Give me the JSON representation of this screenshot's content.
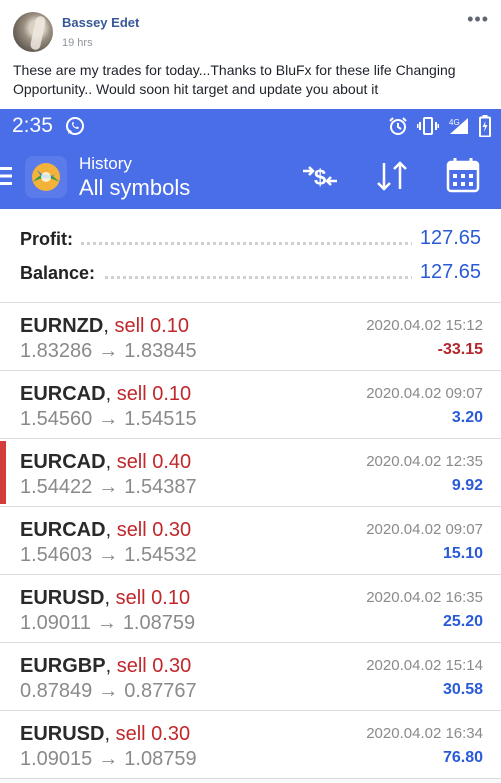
{
  "post": {
    "author": "Bassey Edet",
    "time": "19 hrs",
    "more": "•••",
    "text": "These are my trades for today...Thanks to BluFx for these life Changing Opportunity.. Would soon hit target and update you about it"
  },
  "phone": {
    "status": {
      "clock": "2:35",
      "icons": [
        "whatsapp-icon",
        "alarm-icon",
        "vibrate-icon",
        "4g-signal-icon",
        "battery-icon"
      ]
    },
    "appbar": {
      "title_small": "History",
      "title_large": "All symbols",
      "icons": [
        "menu-icon",
        "metatrader-logo-icon",
        "deposit-exchange-icon",
        "sort-icon",
        "calendar-icon"
      ]
    },
    "summary": [
      {
        "label": "Profit:",
        "value": "127.65"
      },
      {
        "label": "Balance:",
        "value": "127.65"
      }
    ],
    "trades": [
      {
        "symbol": "EURNZD",
        "side": "sell 0.10",
        "open": "1.83286",
        "close": "1.83845",
        "time": "2020.04.02 15:12",
        "pl": "-33.15",
        "pl_color": "#b3262b",
        "selected": false
      },
      {
        "symbol": "EURCAD",
        "side": "sell 0.10",
        "open": "1.54560",
        "close": "1.54515",
        "time": "2020.04.02 09:07",
        "pl": "3.20",
        "pl_color": "#2a5bd7",
        "selected": false
      },
      {
        "symbol": "EURCAD",
        "side": "sell 0.40",
        "open": "1.54422",
        "close": "1.54387",
        "time": "2020.04.02 12:35",
        "pl": "9.92",
        "pl_color": "#2a5bd7",
        "selected": true
      },
      {
        "symbol": "EURCAD",
        "side": "sell 0.30",
        "open": "1.54603",
        "close": "1.54532",
        "time": "2020.04.02 09:07",
        "pl": "15.10",
        "pl_color": "#2a5bd7",
        "selected": false
      },
      {
        "symbol": "EURUSD",
        "side": "sell 0.10",
        "open": "1.09011",
        "close": "1.08759",
        "time": "2020.04.02 16:35",
        "pl": "25.20",
        "pl_color": "#2a5bd7",
        "selected": false
      },
      {
        "symbol": "EURGBP",
        "side": "sell 0.30",
        "open": "0.87849",
        "close": "0.87767",
        "time": "2020.04.02 15:14",
        "pl": "30.58",
        "pl_color": "#2a5bd7",
        "selected": false
      },
      {
        "symbol": "EURUSD",
        "side": "sell 0.30",
        "open": "1.09015",
        "close": "1.08759",
        "time": "2020.04.02 16:34",
        "pl": "76.80",
        "pl_color": "#2a5bd7",
        "selected": false
      }
    ],
    "arrow_glyph": "→",
    "colors": {
      "accent": "#4a6ee8",
      "sell": "#c0282b",
      "profit": "#2a5bd7",
      "loss": "#b3262b"
    }
  }
}
